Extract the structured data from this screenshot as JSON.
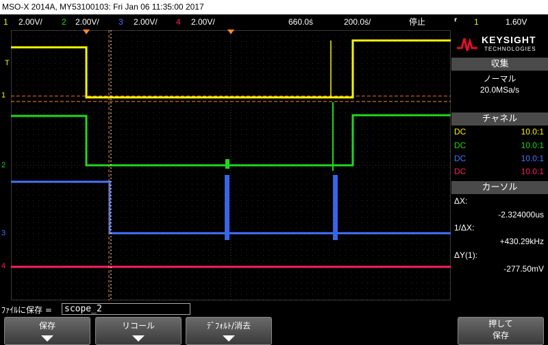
{
  "title": "MSO-X 2014A, MY53100103: Fri Jan 06 11:35:00 2017",
  "channel_bar": {
    "ch1": {
      "num": "1",
      "scale": "2.00V/",
      "color": "#f7f700"
    },
    "ch2": {
      "num": "2",
      "scale": "2.00V/",
      "color": "#1ed81e"
    },
    "ch3": {
      "num": "3",
      "scale": "2.00V/",
      "color": "#4a72ff"
    },
    "ch4": {
      "num": "4",
      "scale": "2.00V/",
      "color": "#ff1e63"
    },
    "timebase": "660.0ś",
    "time_scale": "200.0ś/",
    "run_state": "停止",
    "trigger_icon": "trigger-edge-icon",
    "trigger_channel": "1",
    "trigger_level": "1.60V"
  },
  "brand": {
    "name": "KEYSIGHT",
    "sub": "TECHNOLOGIES",
    "color": "#e0102a"
  },
  "panel": {
    "acquire": {
      "header": "収集",
      "mode": "ノーマル",
      "rate": "20.0MSa/s"
    },
    "channels": {
      "header": "チャネル",
      "rows": [
        {
          "coupling": "DC",
          "probe": "10.0:1",
          "color": "#f7f700"
        },
        {
          "coupling": "DC",
          "probe": "10.0:1",
          "color": "#1ed81e"
        },
        {
          "coupling": "DC",
          "probe": "10.0:1",
          "color": "#4a72ff"
        },
        {
          "coupling": "DC",
          "probe": "10.0:1",
          "color": "#ff1e63"
        }
      ]
    },
    "cursors": {
      "header": "カーソル",
      "dx_label": "ΔX:",
      "dx_value": "-2.324000us",
      "inv_dx_label": "1/ΔX:",
      "inv_dx_value": "+430.29kHz",
      "dy_label": "ΔY(1):",
      "dy_value": "-277.50mV"
    }
  },
  "save_bar": {
    "label": "ﾌｧｲﾙに保存 =",
    "filename": "scope_2"
  },
  "softkeys": {
    "save": "保存",
    "recall": "リコール",
    "default_erase": "ﾃﾞﾌｫﾙﾄ/消去",
    "press_to_save_1": "押して",
    "press_to_save_2": "保存"
  },
  "markers": {
    "trigger_label": "T",
    "ch1": "1",
    "ch2": "2",
    "ch3": "3",
    "ch4": "4"
  }
}
